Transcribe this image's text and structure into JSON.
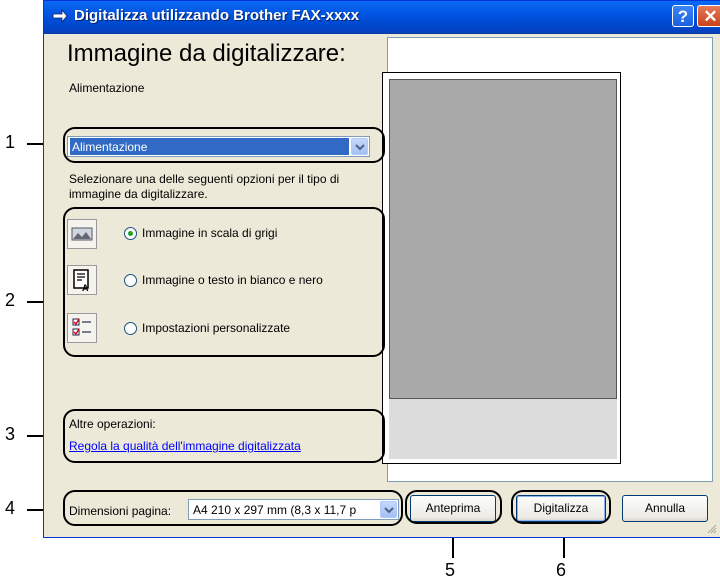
{
  "window": {
    "title": "Digitalizza utilizzando Brother FAX-xxxx",
    "help_glyph": "?",
    "close_glyph": "✕"
  },
  "heading": "Immagine da digitalizzare:",
  "source": {
    "label": "Alimentazione",
    "value": "Alimentazione"
  },
  "instructions": {
    "line1": "Selezionare una delle seguenti opzioni per il tipo di",
    "line2": "immagine da digitalizzare."
  },
  "options": [
    {
      "label": "Immagine in scala di grigi",
      "icon": "grayscale-photo-icon",
      "selected": true
    },
    {
      "label": "Immagine o testo in bianco e nero",
      "icon": "black-white-text-icon",
      "selected": false
    },
    {
      "label": "Impostazioni personalizzate",
      "icon": "custom-settings-icon",
      "selected": false
    }
  ],
  "other_operations": {
    "label": "Altre operazioni:",
    "link": "Regola la qualità dell'immagine digitalizzata"
  },
  "page_size": {
    "label": "Dimensioni pagina:",
    "value": "A4 210 x 297 mm (8,3 x 11,7 p"
  },
  "buttons": {
    "preview": "Anteprima",
    "scan": "Digitalizza",
    "cancel": "Annulla"
  },
  "callouts": [
    "1",
    "2",
    "3",
    "4",
    "5",
    "6"
  ],
  "colors": {
    "title_bar": "#0052e0",
    "dialog_bg": "#ece9d8",
    "selection": "#316ac5",
    "link": "#0000ff"
  }
}
